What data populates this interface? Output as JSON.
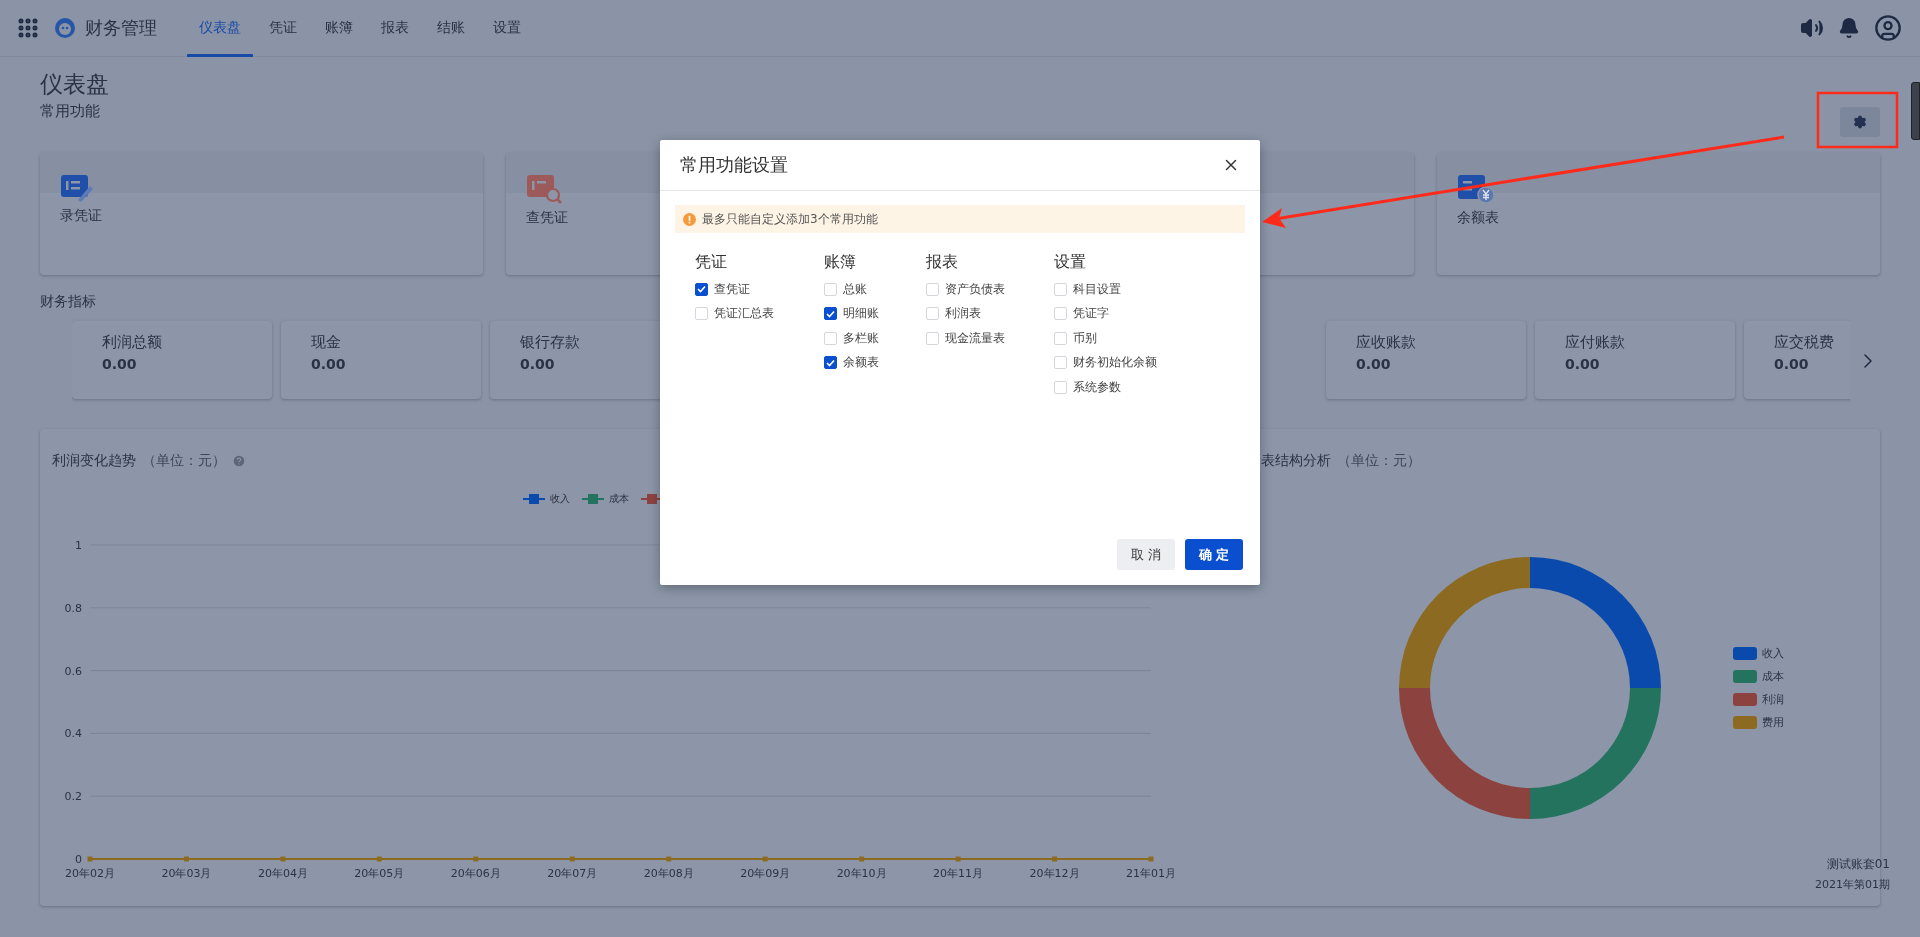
{
  "topbar": {
    "app_name": "财务管理",
    "nav": [
      {
        "label": "仪表盘",
        "selected": true
      },
      {
        "label": "凭证",
        "selected": false
      },
      {
        "label": "账簿",
        "selected": false
      },
      {
        "label": "报表",
        "selected": false
      },
      {
        "label": "结账",
        "selected": false
      },
      {
        "label": "设置",
        "selected": false
      }
    ]
  },
  "page": {
    "title": "仪表盘",
    "subtitle": "常用功能"
  },
  "shortcuts": [
    {
      "label": "录凭证",
      "kind": "voucher-edit"
    },
    {
      "label": "查凭证",
      "kind": "voucher-search"
    },
    {
      "label": "余额表",
      "kind": "balance"
    }
  ],
  "indicators_title": "财务指标",
  "indicators": [
    {
      "label": "利润总额",
      "value": "0.00"
    },
    {
      "label": "现金",
      "value": "0.00"
    },
    {
      "label": "银行存款",
      "value": "0.00"
    },
    {
      "label": "应收账款",
      "value": "0.00"
    },
    {
      "label": "应付账款",
      "value": "0.00"
    },
    {
      "label": "应交税费",
      "value": "0.00"
    }
  ],
  "trend_panel": {
    "unit": "（单位：元）",
    "chart_data": {
      "type": "line",
      "title": "利润变化趋势",
      "categories": [
        "20年02月",
        "20年03月",
        "20年04月",
        "20年05月",
        "20年06月",
        "20年07月",
        "20年08月",
        "20年09月",
        "20年10月",
        "20年11月",
        "20年12月",
        "21年01月"
      ],
      "ylim": [
        0,
        1
      ],
      "yticks": [
        0,
        0.2,
        0.4,
        0.6,
        0.8,
        1
      ],
      "series": [
        {
          "name": "收入",
          "color": "#0b4aad",
          "marker": "square",
          "values": [
            null,
            null,
            null,
            null,
            null,
            null,
            null,
            null,
            null,
            null,
            null,
            null
          ]
        },
        {
          "name": "成本",
          "color": "#24735f",
          "marker": "square",
          "values": [
            null,
            null,
            null,
            null,
            null,
            null,
            null,
            null,
            null,
            null,
            null,
            null
          ]
        },
        {
          "color": "#8c433f",
          "marker": "square",
          "values": [
            null,
            null,
            null,
            null,
            null,
            null,
            null,
            null,
            null,
            null,
            null,
            null
          ]
        },
        {
          "color": "#8c6a22",
          "marker": "square",
          "values": [
            0,
            0,
            0,
            0,
            0,
            0,
            0,
            0,
            0,
            0,
            0,
            0
          ]
        }
      ],
      "grid": true
    }
  },
  "structure_panel": {
    "title": "表结构分析",
    "unit": "（单位：元）",
    "legend": [
      {
        "label": "收入",
        "color": "#0b4aad"
      },
      {
        "label": "成本",
        "color": "#24735f"
      },
      {
        "label": "利润",
        "color": "#8c433f"
      },
      {
        "label": "费用",
        "color": "#8c6a22"
      }
    ],
    "account": "测试账套01",
    "period": "2021年第01期"
  },
  "dialog": {
    "title": "常用功能设置",
    "notice": "最多只能自定义添加3个常用功能",
    "groups": [
      {
        "title": "凭证",
        "options": [
          {
            "label": "查凭证",
            "checked": true
          },
          {
            "label": "凭证汇总表",
            "checked": false
          }
        ]
      },
      {
        "title": "账簿",
        "options": [
          {
            "label": "总账",
            "checked": false
          },
          {
            "label": "明细账",
            "checked": true
          },
          {
            "label": "多栏账",
            "checked": false
          },
          {
            "label": "余额表",
            "checked": true
          }
        ]
      },
      {
        "title": "报表",
        "options": [
          {
            "label": "资产负债表",
            "checked": false
          },
          {
            "label": "利润表",
            "checked": false
          },
          {
            "label": "现金流量表",
            "checked": false
          }
        ]
      },
      {
        "title": "设置",
        "options": [
          {
            "label": "科目设置",
            "checked": false
          },
          {
            "label": "凭证字",
            "checked": false
          },
          {
            "label": "币别",
            "checked": false
          },
          {
            "label": "财务初始化余额",
            "checked": false
          },
          {
            "label": "系统参数",
            "checked": false
          }
        ]
      }
    ],
    "buttons": [
      {
        "label": "取 消",
        "kind": "secondary"
      },
      {
        "label": "确 定",
        "kind": "primary"
      }
    ]
  }
}
